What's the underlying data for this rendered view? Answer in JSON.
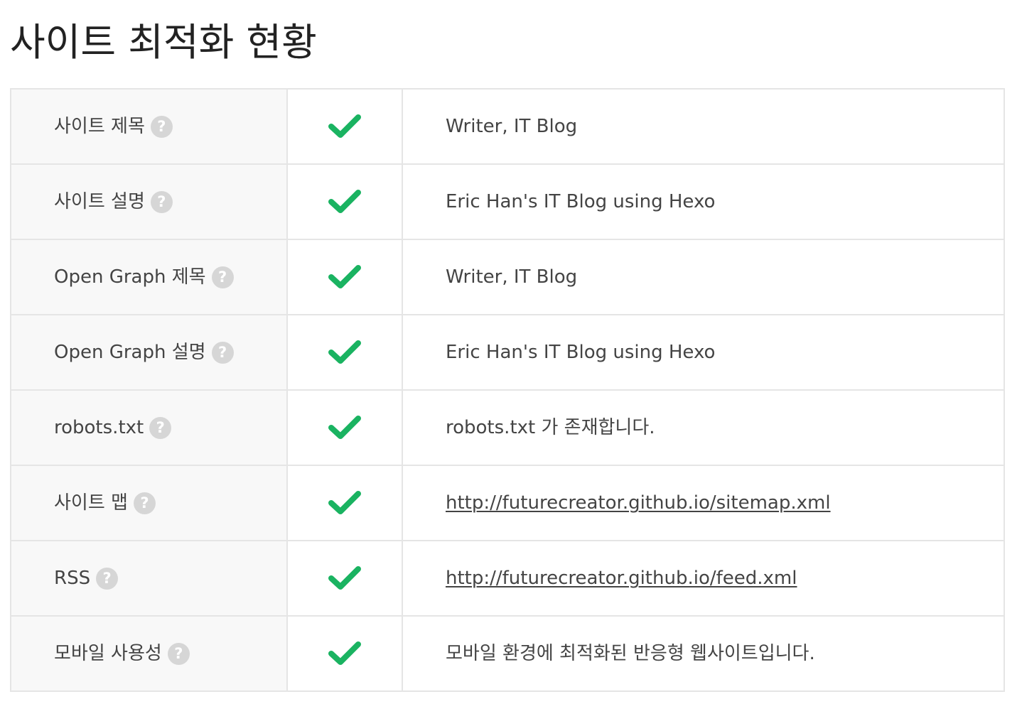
{
  "page": {
    "title": "사이트 최적화 현황"
  },
  "theme": {
    "check_color": "#1ab361",
    "help_icon_color": "#d6d6d6",
    "label_cell_bg": "#f8f8f8",
    "border_color": "#e5e5e5"
  },
  "help_icon": {
    "glyph": "?",
    "icon": "help-circle-icon"
  },
  "rows": [
    {
      "label": "사이트 제목",
      "status": "pass",
      "status_icon": "check-icon",
      "value": "Writer, IT Blog",
      "is_link": false
    },
    {
      "label": "사이트 설명",
      "status": "pass",
      "status_icon": "check-icon",
      "value": "Eric Han's IT Blog using Hexo",
      "is_link": false
    },
    {
      "label": "Open Graph 제목",
      "status": "pass",
      "status_icon": "check-icon",
      "value": "Writer, IT Blog",
      "is_link": false
    },
    {
      "label": "Open Graph 설명",
      "status": "pass",
      "status_icon": "check-icon",
      "value": "Eric Han's IT Blog using Hexo",
      "is_link": false
    },
    {
      "label": "robots.txt",
      "status": "pass",
      "status_icon": "check-icon",
      "value": "robots.txt 가 존재합니다.",
      "is_link": false
    },
    {
      "label": "사이트 맵",
      "status": "pass",
      "status_icon": "check-icon",
      "value": "http://futurecreator.github.io/sitemap.xml",
      "is_link": true
    },
    {
      "label": "RSS",
      "status": "pass",
      "status_icon": "check-icon",
      "value": "http://futurecreator.github.io/feed.xml",
      "is_link": true
    },
    {
      "label": "모바일 사용성",
      "status": "pass",
      "status_icon": "check-icon",
      "value": "모바일 환경에 최적화된 반응형 웹사이트입니다.",
      "is_link": false
    }
  ]
}
